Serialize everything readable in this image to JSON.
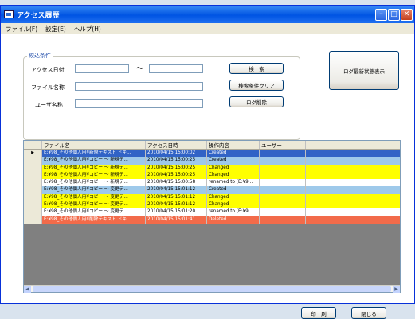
{
  "window": {
    "title": "アクセス履歴",
    "buttons": [
      "–",
      "□",
      "✕"
    ]
  },
  "menu": [
    "ファイル(F)",
    "設定(E)",
    "ヘルプ(H)"
  ],
  "filter": {
    "group_label": "絞込条件",
    "access_date_label": "アクセス日付",
    "range_sep": "〜",
    "file_name_label": "ファイル名称",
    "user_name_label": "ユーザ名称",
    "search_button": "検　索",
    "clear_button": "検索条件クリア",
    "delete_button": "ログ削除"
  },
  "latest_button": "ログ最新状態表示",
  "grid": {
    "columns": [
      "",
      "ファイル名",
      "アクセス日時",
      "操作内容",
      "ユーザー"
    ],
    "selector_mark": "▶",
    "rows": [
      {
        "file": "E:¥98_その他個人用¥新規テキスト ドキ...",
        "date": "2010/04/15 15:00:02",
        "op": "Created",
        "user": "",
        "bg": "#3163c6",
        "fg": "#ffffff"
      },
      {
        "file": "E:¥98_その他個人用¥コピー ～ 新規テ...",
        "date": "2010/04/15 15:00:25",
        "op": "Created",
        "user": "",
        "bg": "#9ec9ea",
        "fg": "#000000"
      },
      {
        "file": "E:¥98_その他個人用¥コピー ～ 新規テ...",
        "date": "2010/04/15 15:00:25",
        "op": "Changed",
        "user": "",
        "bg": "#ffff00",
        "fg": "#000000"
      },
      {
        "file": "E:¥98_その他個人用¥コピー ～ 新規テ...",
        "date": "2010/04/15 15:00:25",
        "op": "Changed",
        "user": "",
        "bg": "#ffff00",
        "fg": "#000000"
      },
      {
        "file": "E:¥98_その他個人用¥コピー ～ 新規テ...",
        "date": "2010/04/15 15:00:58",
        "op": "renamed to [E:¥9...",
        "user": "",
        "bg": "#ffffff",
        "fg": "#000000"
      },
      {
        "file": "E:¥98_その他個人用¥コピー ～ 変更テ...",
        "date": "2010/04/15 15:01:12",
        "op": "Created",
        "user": "",
        "bg": "#9ec9ea",
        "fg": "#000000"
      },
      {
        "file": "E:¥98_その他個人用¥コピー ～ 変更テ...",
        "date": "2010/04/15 15:01:12",
        "op": "Changed",
        "user": "",
        "bg": "#ffff00",
        "fg": "#000000"
      },
      {
        "file": "E:¥98_その他個人用¥コピー ～ 変更テ...",
        "date": "2010/04/15 15:01:12",
        "op": "Changed",
        "user": "",
        "bg": "#ffff00",
        "fg": "#000000"
      },
      {
        "file": "E:¥98_その他個人用¥コピー ～ 変更テ...",
        "date": "2010/04/15 15:01:20",
        "op": "renamed to [E:¥9...",
        "user": "",
        "bg": "#ffffff",
        "fg": "#000000"
      },
      {
        "file": "E:¥98_その他個人用¥削除テキスト ドキ...",
        "date": "2010/04/15 15:01:41",
        "op": "Deleted",
        "user": "",
        "bg": "#f26b4a",
        "fg": "#ffffff"
      }
    ]
  },
  "footer": {
    "print_button": "印　刷",
    "close_button": "閉じる"
  }
}
